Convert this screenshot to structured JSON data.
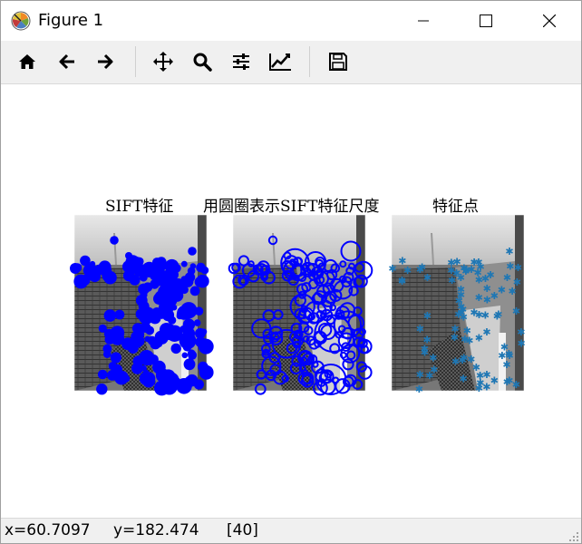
{
  "window": {
    "title": "Figure 1",
    "controls": [
      "minimize",
      "maximize",
      "close"
    ]
  },
  "toolbar": {
    "tools": [
      {
        "name": "home",
        "icon": "home-icon"
      },
      {
        "name": "back",
        "icon": "arrow-left-icon"
      },
      {
        "name": "forward",
        "icon": "arrow-right-icon"
      },
      {
        "name": "pan",
        "icon": "move-icon"
      },
      {
        "name": "zoom",
        "icon": "magnifier-icon"
      },
      {
        "name": "subplots",
        "icon": "sliders-icon"
      },
      {
        "name": "edit-axes",
        "icon": "line-chart-icon"
      },
      {
        "name": "save",
        "icon": "floppy-disk-icon"
      }
    ]
  },
  "figure": {
    "panels": [
      {
        "title": "SIFT特征",
        "marker_style": "filled-blue-dots",
        "color": "#0000ff"
      },
      {
        "title": "用圆圈表示SIFT特征尺度",
        "marker_style": "blue-circles",
        "color": "#0000ff"
      },
      {
        "title": "特征点",
        "marker_style": "steelblue-stars",
        "color": "#1f77b4"
      }
    ]
  },
  "status": {
    "x_readout": "x=60.7097",
    "y_readout": "y=182.474",
    "pixel_value": "[40]"
  }
}
